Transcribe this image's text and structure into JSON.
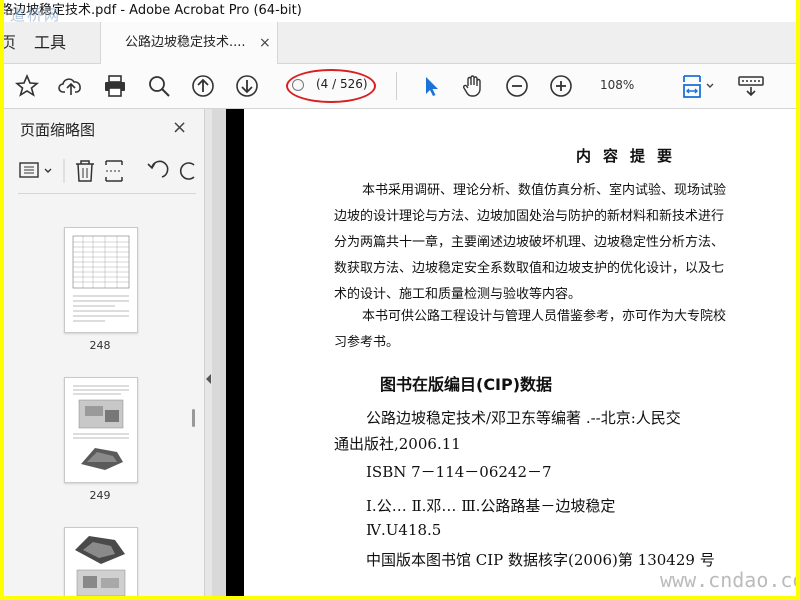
{
  "window": {
    "title": "路边坡稳定技术.pdf - Adobe Acrobat Pro (64-bit)",
    "watermark_top": "道桥网"
  },
  "tabs": {
    "prev_glyph": "页",
    "tools_label": "工具",
    "doc_label": "公路边坡稳定技术....",
    "close_glyph": "×"
  },
  "toolbar": {
    "page_indicator": "(4 / 526)",
    "zoom": "108%",
    "icons": [
      "star-icon",
      "cloud-upload-icon",
      "print-icon",
      "zoom-search-icon",
      "page-up-icon",
      "page-down-icon",
      "select-arrow-icon",
      "hand-icon",
      "zoom-out-icon",
      "zoom-in-icon",
      "fit-page-icon",
      "keyboard-icon"
    ]
  },
  "thumbnails_panel": {
    "title": "页面缩略图",
    "close_glyph": "×",
    "pages": [
      {
        "label": "248"
      },
      {
        "label": "249"
      },
      {
        "label": ""
      }
    ]
  },
  "document": {
    "heading": "内容提要",
    "summary_lines": [
      "本书采用调研、理论分析、数值仿真分析、室内试验、现场试验",
      "边坡的设计理论与方法、边坡加固处治与防护的新材料和新技术进行",
      "分为两篇共十一章，主要阐述边坡破坏机理、边坡稳定性分析方法、",
      "数获取方法、边坡稳定安全系数取值和边坡支护的优化设计，以及七",
      "术的设计、施工和质量检测与验收等内容。",
      "本书可供公路工程设计与管理人员借鉴参考，亦可作为大专院校",
      "习参考书。"
    ],
    "cip_title": "图书在版编目(CIP)数据",
    "cip_lines": [
      "公路边坡稳定技术/邓卫东等编著 .--北京:人民交",
      "通出版社,2006.11",
      "ISBN 7－114－06242－7",
      "Ⅰ.公…  Ⅱ.邓…  Ⅲ.公路路基－边坡稳定",
      "Ⅳ.U418.5",
      "中国版本图书馆 CIP 数据核字(2006)第 130429 号"
    ],
    "watermark_bottom": "www.cndao.com"
  },
  "colors": {
    "border": "#ffff00",
    "annotation_ellipse": "#d82020",
    "select_icon": "#1a73d9"
  }
}
